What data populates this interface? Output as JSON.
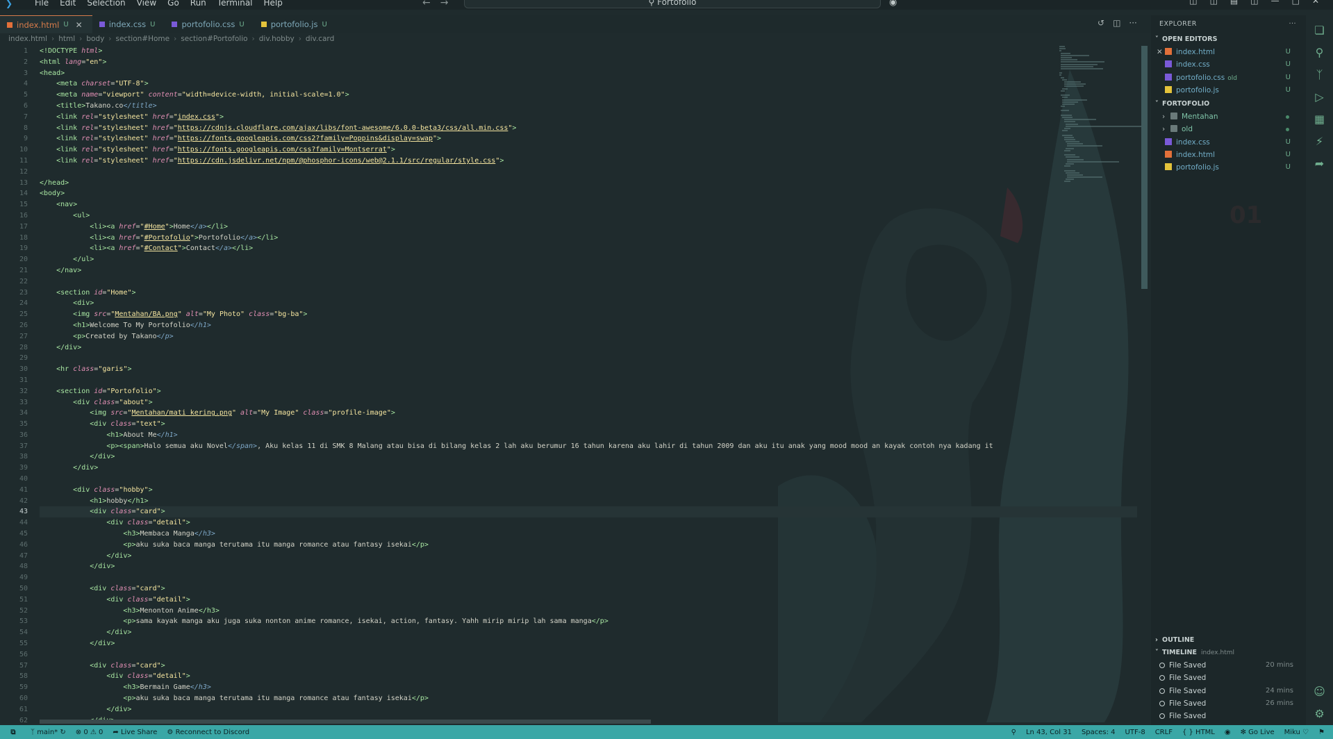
{
  "menu": [
    "File",
    "Edit",
    "Selection",
    "View",
    "Go",
    "Run",
    "Terminal",
    "Help"
  ],
  "search_title": "Fortofolio",
  "tabs": [
    {
      "name": "index.html",
      "status": "U",
      "color": "#e2703a"
    },
    {
      "name": "index.css",
      "status": "U",
      "color": "#7a5ad8"
    },
    {
      "name": "portofolio.css",
      "status": "U",
      "color": "#7a5ad8"
    },
    {
      "name": "portofolio.js",
      "status": "U",
      "color": "#e4c33b"
    }
  ],
  "breadcrumb": [
    "index.html",
    "html",
    "body",
    "section#Home",
    "section#Portofolio",
    "div.hobby",
    "div.card"
  ],
  "explorer": {
    "title": "EXPLORER",
    "open_editors_title": "OPEN EDITORS",
    "open_editors": [
      {
        "name": "index.html",
        "status": "U",
        "color": "#e2703a"
      },
      {
        "name": "index.css",
        "status": "U",
        "color": "#7a5ad8"
      },
      {
        "name": "portofolio.css",
        "note": "old",
        "status": "U",
        "color": "#7a5ad8"
      },
      {
        "name": "portofolio.js",
        "status": "U",
        "color": "#e4c33b"
      }
    ],
    "folder_title": "FORTOFOLIO",
    "folder_items": [
      {
        "name": "Mentahan",
        "type": "folder"
      },
      {
        "name": "old",
        "type": "folder"
      },
      {
        "name": "index.css",
        "status": "U",
        "color": "#7a5ad8"
      },
      {
        "name": "index.html",
        "status": "U",
        "color": "#e2703a"
      },
      {
        "name": "portofolio.js",
        "status": "U",
        "color": "#e4c33b"
      }
    ],
    "outline_title": "OUTLINE",
    "timeline_title": "TIMELINE",
    "timeline_file": "index.html",
    "timeline": [
      {
        "label": "File Saved",
        "time": "20 mins"
      },
      {
        "label": "File Saved",
        "time": ""
      },
      {
        "label": "File Saved",
        "time": "24 mins"
      },
      {
        "label": "File Saved",
        "time": "26 mins"
      },
      {
        "label": "File Saved",
        "time": ""
      }
    ]
  },
  "current_line": 43,
  "code_lines": [
    [
      [
        "t",
        "<!DOCTYPE "
      ],
      [
        "a",
        "html"
      ],
      [
        "t",
        ">"
      ]
    ],
    [
      [
        "t",
        "<html "
      ],
      [
        "a",
        "lang"
      ],
      [
        "x",
        "="
      ],
      [
        "s",
        "\"en\""
      ],
      [
        "t",
        ">"
      ]
    ],
    [
      [
        "t",
        "<head>"
      ]
    ],
    [
      [
        "x",
        "    "
      ],
      [
        "t",
        "<meta "
      ],
      [
        "a",
        "charset"
      ],
      [
        "x",
        "="
      ],
      [
        "s",
        "\"UTF-8\""
      ],
      [
        "t",
        ">"
      ]
    ],
    [
      [
        "x",
        "    "
      ],
      [
        "t",
        "<meta "
      ],
      [
        "a",
        "name"
      ],
      [
        "x",
        "="
      ],
      [
        "s",
        "\"viewport\""
      ],
      [
        "x",
        " "
      ],
      [
        "a",
        "content"
      ],
      [
        "x",
        "="
      ],
      [
        "s",
        "\"width=device-width, initial-scale=1.0\""
      ],
      [
        "t",
        ">"
      ]
    ],
    [
      [
        "x",
        "    "
      ],
      [
        "t",
        "<title>"
      ],
      [
        "x",
        "Takano.co"
      ],
      [
        "d",
        "</title>"
      ]
    ],
    [
      [
        "x",
        "    "
      ],
      [
        "t",
        "<link "
      ],
      [
        "a",
        "rel"
      ],
      [
        "x",
        "="
      ],
      [
        "s",
        "\"stylesheet\""
      ],
      [
        "x",
        " "
      ],
      [
        "a",
        "href"
      ],
      [
        "x",
        "="
      ],
      [
        "s",
        "\""
      ],
      [
        "u",
        "index.css"
      ],
      [
        "s",
        "\""
      ],
      [
        "t",
        ">"
      ]
    ],
    [
      [
        "x",
        "    "
      ],
      [
        "t",
        "<link "
      ],
      [
        "a",
        "rel"
      ],
      [
        "x",
        "="
      ],
      [
        "s",
        "\"stylesheet\""
      ],
      [
        "x",
        " "
      ],
      [
        "a",
        "href"
      ],
      [
        "x",
        "="
      ],
      [
        "s",
        "\""
      ],
      [
        "u",
        "https://cdnjs.cloudflare.com/ajax/libs/font-awesome/6.0.0-beta3/css/all.min.css"
      ],
      [
        "s",
        "\""
      ],
      [
        "t",
        ">"
      ]
    ],
    [
      [
        "x",
        "    "
      ],
      [
        "t",
        "<link "
      ],
      [
        "a",
        "rel"
      ],
      [
        "x",
        "="
      ],
      [
        "s",
        "\"stylesheet\""
      ],
      [
        "x",
        " "
      ],
      [
        "a",
        "href"
      ],
      [
        "x",
        "="
      ],
      [
        "s",
        "\""
      ],
      [
        "u",
        "https://fonts.googleapis.com/css2?family=Poppins&display=swap"
      ],
      [
        "s",
        "\""
      ],
      [
        "t",
        ">"
      ]
    ],
    [
      [
        "x",
        "    "
      ],
      [
        "t",
        "<link "
      ],
      [
        "a",
        "rel"
      ],
      [
        "x",
        "="
      ],
      [
        "s",
        "\"stylesheet\""
      ],
      [
        "x",
        " "
      ],
      [
        "a",
        "href"
      ],
      [
        "x",
        "="
      ],
      [
        "s",
        "\""
      ],
      [
        "u",
        "https://fonts.googleapis.com/css?family=Montserrat"
      ],
      [
        "s",
        "\""
      ],
      [
        "t",
        ">"
      ]
    ],
    [
      [
        "x",
        "    "
      ],
      [
        "t",
        "<link "
      ],
      [
        "a",
        "rel"
      ],
      [
        "x",
        "="
      ],
      [
        "s",
        "\"stylesheet\""
      ],
      [
        "x",
        " "
      ],
      [
        "a",
        "href"
      ],
      [
        "x",
        "="
      ],
      [
        "s",
        "\""
      ],
      [
        "u",
        "https://cdn.jsdelivr.net/npm/@phosphor-icons/web@2.1.1/src/regular/style.css"
      ],
      [
        "s",
        "\""
      ],
      [
        "t",
        ">"
      ]
    ],
    [],
    [
      [
        "t",
        "</head>"
      ]
    ],
    [
      [
        "t",
        "<body>"
      ]
    ],
    [
      [
        "x",
        "    "
      ],
      [
        "t",
        "<nav>"
      ]
    ],
    [
      [
        "x",
        "        "
      ],
      [
        "t",
        "<ul>"
      ]
    ],
    [
      [
        "x",
        "            "
      ],
      [
        "t",
        "<li><a "
      ],
      [
        "a",
        "href"
      ],
      [
        "x",
        "="
      ],
      [
        "s",
        "\""
      ],
      [
        "u",
        "#Home"
      ],
      [
        "s",
        "\""
      ],
      [
        "t",
        ">"
      ],
      [
        "x",
        "Home"
      ],
      [
        "d",
        "</a>"
      ],
      [
        "t",
        "</li>"
      ]
    ],
    [
      [
        "x",
        "            "
      ],
      [
        "t",
        "<li><a "
      ],
      [
        "a",
        "href"
      ],
      [
        "x",
        "="
      ],
      [
        "s",
        "\""
      ],
      [
        "u",
        "#Portofolio"
      ],
      [
        "s",
        "\""
      ],
      [
        "t",
        ">"
      ],
      [
        "x",
        "Portofolio"
      ],
      [
        "d",
        "</a>"
      ],
      [
        "t",
        "</li>"
      ]
    ],
    [
      [
        "x",
        "            "
      ],
      [
        "t",
        "<li><a "
      ],
      [
        "a",
        "href"
      ],
      [
        "x",
        "="
      ],
      [
        "s",
        "\""
      ],
      [
        "u",
        "#Contact"
      ],
      [
        "s",
        "\""
      ],
      [
        "t",
        ">"
      ],
      [
        "x",
        "Contact"
      ],
      [
        "d",
        "</a>"
      ],
      [
        "t",
        "</li>"
      ]
    ],
    [
      [
        "x",
        "        "
      ],
      [
        "t",
        "</ul>"
      ]
    ],
    [
      [
        "x",
        "    "
      ],
      [
        "t",
        "</nav>"
      ]
    ],
    [],
    [
      [
        "x",
        "    "
      ],
      [
        "t",
        "<section "
      ],
      [
        "a",
        "id"
      ],
      [
        "x",
        "="
      ],
      [
        "s",
        "\"Home\""
      ],
      [
        "t",
        ">"
      ]
    ],
    [
      [
        "x",
        "        "
      ],
      [
        "t",
        "<div>"
      ]
    ],
    [
      [
        "x",
        "        "
      ],
      [
        "t",
        "<img "
      ],
      [
        "a",
        "src"
      ],
      [
        "x",
        "="
      ],
      [
        "s",
        "\""
      ],
      [
        "u",
        "Mentahan/BA.png"
      ],
      [
        "s",
        "\""
      ],
      [
        "x",
        " "
      ],
      [
        "a",
        "alt"
      ],
      [
        "x",
        "="
      ],
      [
        "s",
        "\"My Photo\""
      ],
      [
        "x",
        " "
      ],
      [
        "a",
        "class"
      ],
      [
        "x",
        "="
      ],
      [
        "s",
        "\"bg-ba\""
      ],
      [
        "t",
        ">"
      ]
    ],
    [
      [
        "x",
        "        "
      ],
      [
        "t",
        "<h1>"
      ],
      [
        "x",
        "Welcome To My Portofolio"
      ],
      [
        "d",
        "</h1>"
      ]
    ],
    [
      [
        "x",
        "        "
      ],
      [
        "t",
        "<p>"
      ],
      [
        "x",
        "Created by Takano"
      ],
      [
        "d",
        "</p>"
      ]
    ],
    [
      [
        "x",
        "    "
      ],
      [
        "t",
        "</div>"
      ]
    ],
    [],
    [
      [
        "x",
        "    "
      ],
      [
        "t",
        "<hr "
      ],
      [
        "a",
        "class"
      ],
      [
        "x",
        "="
      ],
      [
        "s",
        "\"garis\""
      ],
      [
        "t",
        ">"
      ]
    ],
    [],
    [
      [
        "x",
        "    "
      ],
      [
        "t",
        "<section "
      ],
      [
        "a",
        "id"
      ],
      [
        "x",
        "="
      ],
      [
        "s",
        "\"Portofolio\""
      ],
      [
        "t",
        ">"
      ]
    ],
    [
      [
        "x",
        "        "
      ],
      [
        "t",
        "<div "
      ],
      [
        "a",
        "class"
      ],
      [
        "x",
        "="
      ],
      [
        "s",
        "\"about\""
      ],
      [
        "t",
        ">"
      ]
    ],
    [
      [
        "x",
        "            "
      ],
      [
        "t",
        "<img "
      ],
      [
        "a",
        "src"
      ],
      [
        "x",
        "="
      ],
      [
        "s",
        "\""
      ],
      [
        "u",
        "Mentahan/mati kering.png"
      ],
      [
        "s",
        "\""
      ],
      [
        "x",
        " "
      ],
      [
        "a",
        "alt"
      ],
      [
        "x",
        "="
      ],
      [
        "s",
        "\"My Image\""
      ],
      [
        "x",
        " "
      ],
      [
        "a",
        "class"
      ],
      [
        "x",
        "="
      ],
      [
        "s",
        "\"profile-image\""
      ],
      [
        "t",
        ">"
      ]
    ],
    [
      [
        "x",
        "            "
      ],
      [
        "t",
        "<div "
      ],
      [
        "a",
        "class"
      ],
      [
        "x",
        "="
      ],
      [
        "s",
        "\"text\""
      ],
      [
        "t",
        ">"
      ]
    ],
    [
      [
        "x",
        "                "
      ],
      [
        "t",
        "<h1>"
      ],
      [
        "x",
        "About Me"
      ],
      [
        "d",
        "</h1>"
      ]
    ],
    [
      [
        "x",
        "                "
      ],
      [
        "t",
        "<p><span>"
      ],
      [
        "x",
        "Halo semua aku Novel"
      ],
      [
        "d",
        "</span>"
      ],
      [
        "x",
        ", Aku kelas 11 di SMK 8 Malang atau bisa di bilang kelas 2 lah aku berumur 16 tahun karena aku lahir di tahun 2009 dan aku itu anak yang mood mood an kayak contoh nya kadang it"
      ]
    ],
    [
      [
        "x",
        "            "
      ],
      [
        "t",
        "</div>"
      ]
    ],
    [
      [
        "x",
        "        "
      ],
      [
        "t",
        "</div>"
      ]
    ],
    [],
    [
      [
        "x",
        "        "
      ],
      [
        "t",
        "<div "
      ],
      [
        "a",
        "class"
      ],
      [
        "x",
        "="
      ],
      [
        "s",
        "\"hobby\""
      ],
      [
        "t",
        ">"
      ]
    ],
    [
      [
        "x",
        "            "
      ],
      [
        "t",
        "<h1>"
      ],
      [
        "x",
        "hobby"
      ],
      [
        "t",
        "</h1>"
      ]
    ],
    [
      [
        "x",
        "            "
      ],
      [
        "t",
        "<div "
      ],
      [
        "a",
        "class"
      ],
      [
        "x",
        "="
      ],
      [
        "s",
        "\"card\""
      ],
      [
        "t",
        ">"
      ]
    ],
    [
      [
        "x",
        "                "
      ],
      [
        "t",
        "<div "
      ],
      [
        "a",
        "class"
      ],
      [
        "x",
        "="
      ],
      [
        "s",
        "\"detail\""
      ],
      [
        "t",
        ">"
      ]
    ],
    [
      [
        "x",
        "                    "
      ],
      [
        "t",
        "<h3>"
      ],
      [
        "x",
        "Membaca Manga"
      ],
      [
        "d",
        "</h3>"
      ]
    ],
    [
      [
        "x",
        "                    "
      ],
      [
        "t",
        "<p>"
      ],
      [
        "x",
        "aku suka baca manga terutama itu manga romance atau fantasy isekai"
      ],
      [
        "t",
        "</p>"
      ]
    ],
    [
      [
        "x",
        "                "
      ],
      [
        "t",
        "</div>"
      ]
    ],
    [
      [
        "x",
        "            "
      ],
      [
        "t",
        "</div>"
      ]
    ],
    [],
    [
      [
        "x",
        "            "
      ],
      [
        "t",
        "<div "
      ],
      [
        "a",
        "class"
      ],
      [
        "x",
        "="
      ],
      [
        "s",
        "\"card\""
      ],
      [
        "t",
        ">"
      ]
    ],
    [
      [
        "x",
        "                "
      ],
      [
        "t",
        "<div "
      ],
      [
        "a",
        "class"
      ],
      [
        "x",
        "="
      ],
      [
        "s",
        "\"detail\""
      ],
      [
        "t",
        ">"
      ]
    ],
    [
      [
        "x",
        "                    "
      ],
      [
        "t",
        "<h3>"
      ],
      [
        "x",
        "Menonton Anime"
      ],
      [
        "t",
        "</h3>"
      ]
    ],
    [
      [
        "x",
        "                    "
      ],
      [
        "t",
        "<p>"
      ],
      [
        "x",
        "sama kayak manga aku juga suka nonton anime romance, isekai, action, fantasy. Yahh mirip mirip lah sama manga"
      ],
      [
        "t",
        "</p>"
      ]
    ],
    [
      [
        "x",
        "                "
      ],
      [
        "t",
        "</div>"
      ]
    ],
    [
      [
        "x",
        "            "
      ],
      [
        "t",
        "</div>"
      ]
    ],
    [],
    [
      [
        "x",
        "            "
      ],
      [
        "t",
        "<div "
      ],
      [
        "a",
        "class"
      ],
      [
        "x",
        "="
      ],
      [
        "s",
        "\"card\""
      ],
      [
        "t",
        ">"
      ]
    ],
    [
      [
        "x",
        "                "
      ],
      [
        "t",
        "<div "
      ],
      [
        "a",
        "class"
      ],
      [
        "x",
        "="
      ],
      [
        "s",
        "\"detail\""
      ],
      [
        "t",
        ">"
      ]
    ],
    [
      [
        "x",
        "                    "
      ],
      [
        "t",
        "<h3>"
      ],
      [
        "x",
        "Bermain Game"
      ],
      [
        "d",
        "</h3>"
      ]
    ],
    [
      [
        "x",
        "                    "
      ],
      [
        "t",
        "<p>"
      ],
      [
        "x",
        "aku suka baca manga terutama itu manga romance atau fantasy isekai"
      ],
      [
        "t",
        "</p>"
      ]
    ],
    [
      [
        "x",
        "                "
      ],
      [
        "t",
        "</div>"
      ]
    ],
    [
      [
        "x",
        "            "
      ],
      [
        "t",
        "</div>"
      ]
    ]
  ],
  "last_line_number": 62,
  "status": {
    "branch": "main*",
    "problems": "0",
    "warnings": "0",
    "live_share": "Live Share",
    "discord": "Reconnect to Discord",
    "cursor": "Ln 43, Col 31",
    "spaces": "Spaces: 4",
    "encoding": "UTF-8",
    "eol": "CRLF",
    "language": "HTML",
    "go_live": "Go Live",
    "theme": "Miku"
  },
  "bg_number": "01"
}
